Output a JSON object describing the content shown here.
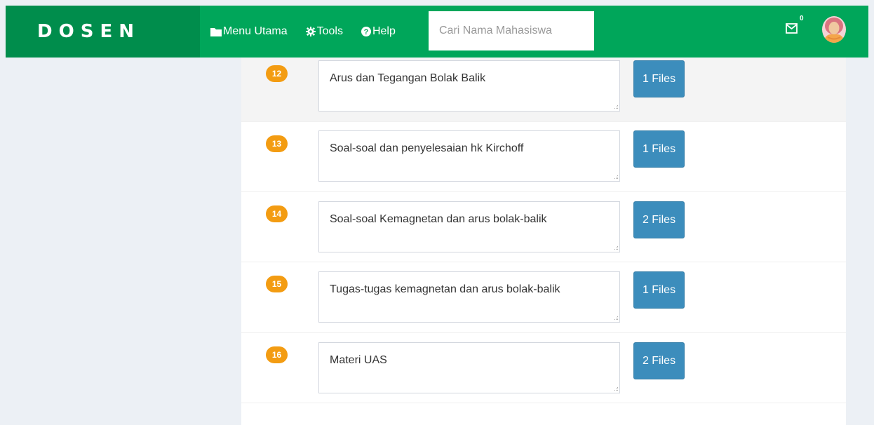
{
  "header": {
    "brand": "DOSEN",
    "nav": [
      {
        "label": "Menu Utama",
        "icon": "folder-icon"
      },
      {
        "label": "Tools",
        "icon": "gear-icon"
      },
      {
        "label": "Help",
        "icon": "question-circle-icon"
      }
    ],
    "search_placeholder": "Cari Nama Mahasiswa",
    "mail_count": "0"
  },
  "colors": {
    "topbar": "#00a65a",
    "brand_bg": "#008d4c",
    "badge": "#f39c12",
    "button": "#3c8dbc"
  },
  "rows": [
    {
      "number": "12",
      "topic": "Arus dan Tegangan Bolak Balik",
      "files": "1 Files"
    },
    {
      "number": "13",
      "topic": "Soal-soal dan penyelesaian hk Kirchoff",
      "files": "1 Files"
    },
    {
      "number": "14",
      "topic": "Soal-soal Kemagnetan dan arus bolak-balik",
      "files": "2 Files"
    },
    {
      "number": "15",
      "topic": "Tugas-tugas kemagnetan dan arus bolak-balik",
      "files": "1 Files"
    },
    {
      "number": "16",
      "topic": "Materi UAS",
      "files": "2 Files"
    }
  ]
}
